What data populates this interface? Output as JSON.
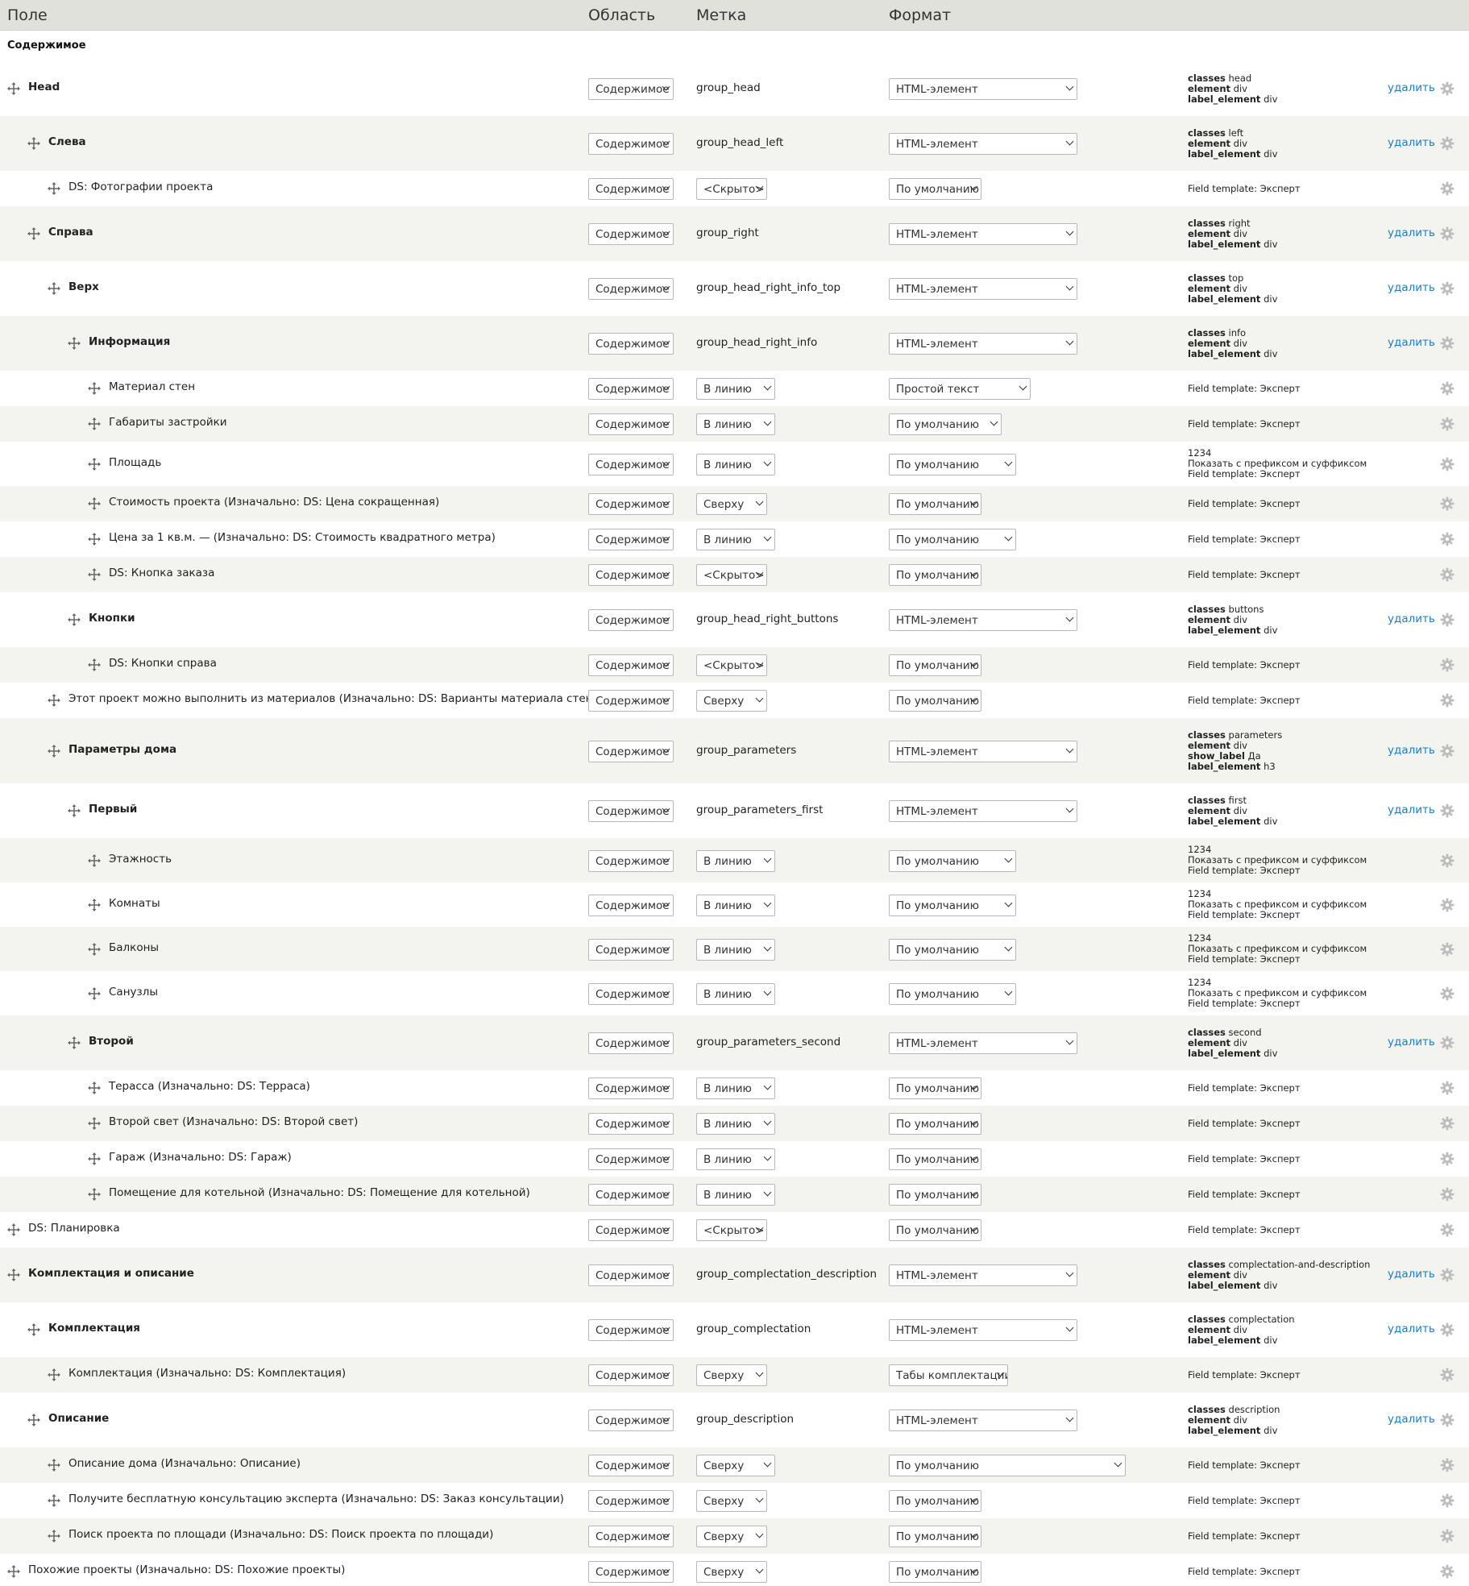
{
  "headers": {
    "field": "Поле",
    "region": "Область",
    "label": "Метка",
    "format": "Формат"
  },
  "region_title": "Содержимое",
  "delete_label": "удалить",
  "colors": {
    "link": "#1f7dbf",
    "even_row": "#f3f3ef",
    "header_bg": "#e1e1dc"
  },
  "rows": [
    {
      "name": "Head",
      "level": 0,
      "bold": true,
      "region": "Содержимое",
      "label_text": "group_head",
      "format": "HTML-элемент",
      "summary": [
        {
          "k": "classes",
          "v": " head"
        },
        {
          "k": "element",
          "v": " div"
        },
        {
          "k": "label_element",
          "v": " div"
        }
      ],
      "delete": true
    },
    {
      "name": "Слева",
      "level": 1,
      "bold": true,
      "region": "Содержимое",
      "label_text": "group_head_left",
      "format": "HTML-элемент",
      "summary": [
        {
          "k": "classes",
          "v": " left"
        },
        {
          "k": "element",
          "v": " div"
        },
        {
          "k": "label_element",
          "v": " div"
        }
      ],
      "delete": true
    },
    {
      "name": "DS: Фотографии проекта",
      "level": 2,
      "region": "Содержимое",
      "label_select": "<Скрыто>",
      "format": "По умолчанию",
      "summary": [
        {
          "k": "",
          "v": "Field template: Эксперт"
        }
      ]
    },
    {
      "name": "Справа",
      "level": 1,
      "bold": true,
      "region": "Содержимое",
      "label_text": "group_right",
      "format": "HTML-элемент",
      "summary": [
        {
          "k": "classes",
          "v": " right"
        },
        {
          "k": "element",
          "v": " div"
        },
        {
          "k": "label_element",
          "v": " div"
        }
      ],
      "delete": true
    },
    {
      "name": "Верх",
      "level": 2,
      "bold": true,
      "region": "Содержимое",
      "label_text": "group_head_right_info_top",
      "format": "HTML-элемент",
      "summary": [
        {
          "k": "classes",
          "v": " top"
        },
        {
          "k": "element",
          "v": " div"
        },
        {
          "k": "label_element",
          "v": " div"
        }
      ],
      "delete": true
    },
    {
      "name": "Информация",
      "level": 3,
      "bold": true,
      "region": "Содержимое",
      "label_text": "group_head_right_info",
      "format": "HTML-элемент",
      "summary": [
        {
          "k": "classes",
          "v": " info"
        },
        {
          "k": "element",
          "v": " div"
        },
        {
          "k": "label_element",
          "v": " div"
        }
      ],
      "delete": true
    },
    {
      "name": "Материал стен",
      "level": 4,
      "region": "Содержимое",
      "label_select": "В линию",
      "format": "Простой текст",
      "summary": [
        {
          "k": "",
          "v": "Field template: Эксперт"
        }
      ]
    },
    {
      "name": "Габариты застройки",
      "level": 4,
      "region": "Содержимое",
      "label_select": "В линию",
      "format": "По умолчанию",
      "summary": [
        {
          "k": "",
          "v": "Field template: Эксперт"
        }
      ]
    },
    {
      "name": "Площадь",
      "level": 4,
      "region": "Содержимое",
      "label_select": "В линию",
      "format": "По умолчанию",
      "summary": [
        {
          "k": "",
          "v": "1234"
        },
        {
          "k": "",
          "v": "Показать с префиксом и суффиксом"
        },
        {
          "k": "",
          "v": "Field template: Эксперт"
        }
      ]
    },
    {
      "name": "Стоимость проекта (Изначально: DS: Цена сокращенная)",
      "level": 4,
      "region": "Содержимое",
      "label_select": "Сверху",
      "format": "По умолчанию",
      "summary": [
        {
          "k": "",
          "v": "Field template: Эксперт"
        }
      ]
    },
    {
      "name": "Цена за 1 кв.м. — (Изначально: DS: Стоимость квадратного метра)",
      "level": 4,
      "region": "Содержимое",
      "label_select": "В линию",
      "format": "По умолчанию",
      "summary": [
        {
          "k": "",
          "v": "Field template: Эксперт"
        }
      ]
    },
    {
      "name": "DS: Кнопка заказа",
      "level": 4,
      "region": "Содержимое",
      "label_select": "<Скрыто>",
      "format": "По умолчанию",
      "summary": [
        {
          "k": "",
          "v": "Field template: Эксперт"
        }
      ]
    },
    {
      "name": "Кнопки",
      "level": 3,
      "bold": true,
      "region": "Содержимое",
      "label_text": "group_head_right_buttons",
      "format": "HTML-элемент",
      "summary": [
        {
          "k": "classes",
          "v": " buttons"
        },
        {
          "k": "element",
          "v": " div"
        },
        {
          "k": "label_element",
          "v": " div"
        }
      ],
      "delete": true
    },
    {
      "name": "DS: Кнопки справа",
      "level": 4,
      "region": "Содержимое",
      "label_select": "<Скрыто>",
      "format": "По умолчанию",
      "summary": [
        {
          "k": "",
          "v": "Field template: Эксперт"
        }
      ]
    },
    {
      "name": "Этот проект можно выполнить из материалов (Изначально: DS: Варианты материала стен)",
      "level": 2,
      "region": "Содержимое",
      "label_select": "Сверху",
      "format": "По умолчанию",
      "summary": [
        {
          "k": "",
          "v": "Field template: Эксперт"
        }
      ]
    },
    {
      "name": "Параметры дома",
      "level": 2,
      "bold": true,
      "region": "Содержимое",
      "label_text": "group_parameters",
      "format": "HTML-элемент",
      "summary": [
        {
          "k": "classes",
          "v": " parameters"
        },
        {
          "k": "element",
          "v": " div"
        },
        {
          "k": "show_label",
          "v": " Да"
        },
        {
          "k": "label_element",
          "v": " h3"
        }
      ],
      "delete": true
    },
    {
      "name": "Первый",
      "level": 3,
      "bold": true,
      "region": "Содержимое",
      "label_text": "group_parameters_first",
      "format": "HTML-элемент",
      "summary": [
        {
          "k": "classes",
          "v": " first"
        },
        {
          "k": "element",
          "v": " div"
        },
        {
          "k": "label_element",
          "v": " div"
        }
      ],
      "delete": true
    },
    {
      "name": "Этажность",
      "level": 4,
      "region": "Содержимое",
      "label_select": "В линию",
      "format": "По умолчанию",
      "summary": [
        {
          "k": "",
          "v": "1234"
        },
        {
          "k": "",
          "v": "Показать с префиксом и суффиксом"
        },
        {
          "k": "",
          "v": "Field template: Эксперт"
        }
      ]
    },
    {
      "name": "Комнаты",
      "level": 4,
      "region": "Содержимое",
      "label_select": "В линию",
      "format": "По умолчанию",
      "summary": [
        {
          "k": "",
          "v": "1234"
        },
        {
          "k": "",
          "v": "Показать с префиксом и суффиксом"
        },
        {
          "k": "",
          "v": "Field template: Эксперт"
        }
      ]
    },
    {
      "name": "Балконы",
      "level": 4,
      "region": "Содержимое",
      "label_select": "В линию",
      "format": "По умолчанию",
      "summary": [
        {
          "k": "",
          "v": "1234"
        },
        {
          "k": "",
          "v": "Показать с префиксом и суффиксом"
        },
        {
          "k": "",
          "v": "Field template: Эксперт"
        }
      ]
    },
    {
      "name": "Санузлы",
      "level": 4,
      "region": "Содержимое",
      "label_select": "В линию",
      "format": "По умолчанию",
      "summary": [
        {
          "k": "",
          "v": "1234"
        },
        {
          "k": "",
          "v": "Показать с префиксом и суффиксом"
        },
        {
          "k": "",
          "v": "Field template: Эксперт"
        }
      ]
    },
    {
      "name": "Второй",
      "level": 3,
      "bold": true,
      "region": "Содержимое",
      "label_text": "group_parameters_second",
      "format": "HTML-элемент",
      "summary": [
        {
          "k": "classes",
          "v": " second"
        },
        {
          "k": "element",
          "v": " div"
        },
        {
          "k": "label_element",
          "v": " div"
        }
      ],
      "delete": true
    },
    {
      "name": "Терасса (Изначально: DS: Терраса)",
      "level": 4,
      "region": "Содержимое",
      "label_select": "В линию",
      "format": "По умолчанию",
      "summary": [
        {
          "k": "",
          "v": "Field template: Эксперт"
        }
      ]
    },
    {
      "name": "Второй свет (Изначально: DS: Второй свет)",
      "level": 4,
      "region": "Содержимое",
      "label_select": "В линию",
      "format": "По умолчанию",
      "summary": [
        {
          "k": "",
          "v": "Field template: Эксперт"
        }
      ]
    },
    {
      "name": "Гараж (Изначально: DS: Гараж)",
      "level": 4,
      "region": "Содержимое",
      "label_select": "В линию",
      "format": "По умолчанию",
      "summary": [
        {
          "k": "",
          "v": "Field template: Эксперт"
        }
      ]
    },
    {
      "name": "Помещение для котельной (Изначально: DS: Помещение для котельной)",
      "level": 4,
      "region": "Содержимое",
      "label_select": "В линию",
      "format": "По умолчанию",
      "summary": [
        {
          "k": "",
          "v": "Field template: Эксперт"
        }
      ]
    },
    {
      "name": "DS: Планировка",
      "level": 0,
      "region": "Содержимое",
      "label_select": "<Скрыто>",
      "format": "По умолчанию",
      "summary": [
        {
          "k": "",
          "v": "Field template: Эксперт"
        }
      ]
    },
    {
      "name": "Комплектация и описание",
      "level": 0,
      "bold": true,
      "region": "Содержимое",
      "label_text": "group_complectation_description",
      "format": "HTML-элемент",
      "summary": [
        {
          "k": "classes",
          "v": " complectation-and-description"
        },
        {
          "k": "element",
          "v": " div"
        },
        {
          "k": "label_element",
          "v": " div"
        }
      ],
      "delete": true
    },
    {
      "name": "Комплектация",
      "level": 1,
      "bold": true,
      "region": "Содержимое",
      "label_text": "group_complectation",
      "format": "HTML-элемент",
      "summary": [
        {
          "k": "classes",
          "v": " complectation"
        },
        {
          "k": "element",
          "v": " div"
        },
        {
          "k": "label_element",
          "v": " div"
        }
      ],
      "delete": true
    },
    {
      "name": "Комплектация (Изначально: DS: Комплектация)",
      "level": 2,
      "region": "Содержимое",
      "label_select": "Сверху",
      "format": "Табы комплектации",
      "summary": [
        {
          "k": "",
          "v": "Field template: Эксперт"
        }
      ]
    },
    {
      "name": "Описание",
      "level": 1,
      "bold": true,
      "region": "Содержимое",
      "label_text": "group_description",
      "format": "HTML-элемент",
      "summary": [
        {
          "k": "classes",
          "v": " description"
        },
        {
          "k": "element",
          "v": " div"
        },
        {
          "k": "label_element",
          "v": " div"
        }
      ],
      "delete": true
    },
    {
      "name": "Описание дома (Изначально: Описание)",
      "level": 2,
      "region": "Содержимое",
      "label_select": "Сверху",
      "format": "По умолчанию",
      "summary": [
        {
          "k": "",
          "v": "Field template: Эксперт"
        }
      ]
    },
    {
      "name": "Получите бесплатную консультацию эксперта (Изначально: DS: Заказ консультации)",
      "level": 2,
      "region": "Содержимое",
      "label_select": "Сверху",
      "format": "По умолчанию",
      "summary": [
        {
          "k": "",
          "v": "Field template: Эксперт"
        }
      ]
    },
    {
      "name": "Поиск проекта по площади (Изначально: DS: Поиск проекта по площади)",
      "level": 2,
      "region": "Содержимое",
      "label_select": "Сверху",
      "format": "По умолчанию",
      "summary": [
        {
          "k": "",
          "v": "Field template: Эксперт"
        }
      ]
    },
    {
      "name": "Похожие проекты (Изначально: DS: Похожие проекты)",
      "level": 0,
      "region": "Содержимое",
      "label_select": "Сверху",
      "format": "По умолчанию",
      "summary": [
        {
          "k": "",
          "v": "Field template: Эксперт"
        }
      ]
    }
  ]
}
